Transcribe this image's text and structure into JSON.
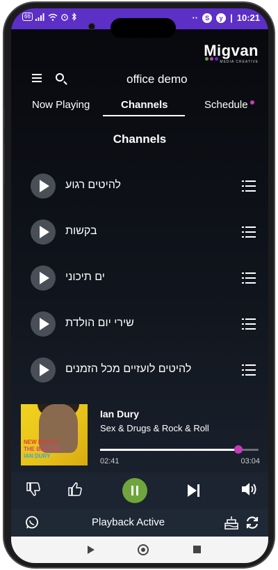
{
  "status_bar": {
    "battery": "66",
    "time": "10:21",
    "dots": "··",
    "separator": "|",
    "badge_s": "S",
    "badge_y": "y"
  },
  "logo": {
    "text": "Migvan",
    "subtitle": "MEDIA CREATIVE"
  },
  "header": {
    "title": "office demo"
  },
  "tabs": [
    {
      "label": "Now Playing",
      "active": false
    },
    {
      "label": "Channels",
      "active": true
    },
    {
      "label": "Schedule",
      "active": false,
      "has_indicator": true
    }
  ],
  "section_title": "Channels",
  "channels": [
    {
      "label": "להיטים רגוע"
    },
    {
      "label": "בקשות"
    },
    {
      "label": "ים תיכוני"
    },
    {
      "label": "שירי יום הולדת"
    },
    {
      "label": "להיטים לועזיים מכל הזמנים"
    }
  ],
  "now_playing": {
    "artist": "Ian Dury",
    "song": "Sex & Drugs & Rock & Roll",
    "current_time": "02:41",
    "total_time": "03:04",
    "progress_fraction": 0.874,
    "album_lines": [
      "NEW BOOTS",
      "THE BEST OF",
      "IAN DURY"
    ]
  },
  "controls": {
    "thumbs_down": "thumbs-down-icon",
    "thumbs_up": "thumbs-up-icon",
    "pause": "pause-icon",
    "next": "skip-next-icon",
    "volume": "volume-icon"
  },
  "bottom_bar": {
    "status_text": "Playback Active"
  },
  "colors": {
    "status_bar": "#5c2fc7",
    "accent": "#c33cb5",
    "play_button": "#6fa53c"
  }
}
